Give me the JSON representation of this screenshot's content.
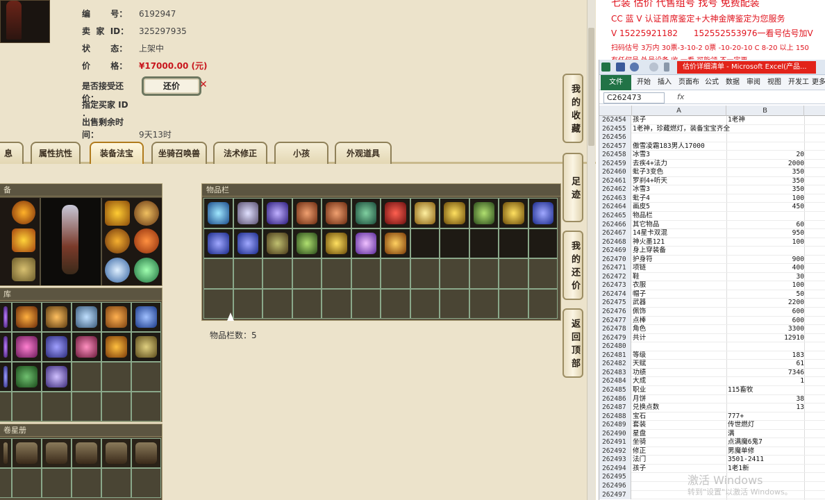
{
  "listing": {
    "rows": [
      {
        "key": "编       号：",
        "value": "6192947"
      },
      {
        "key": "卖  家  ID：",
        "value": "325297935"
      },
      {
        "key": "状       态：",
        "value": "上架中"
      },
      {
        "key": "价       格：",
        "value": "¥17000.00 (元)"
      },
      {
        "key": "是否接受还价：",
        "value": ""
      },
      {
        "key": "指定买家 ID ：",
        "value": ""
      },
      {
        "key": "出售剩余时间：",
        "value": "9天13时"
      }
    ],
    "counter_offer_label": "还价",
    "counter_offer_x": "✕"
  },
  "tabs": [
    {
      "label": "息"
    },
    {
      "label": "属性抗性"
    },
    {
      "label": "装备法宝"
    },
    {
      "label": "坐骑召唤兽"
    },
    {
      "label": "法术修正"
    },
    {
      "label": "小孩"
    },
    {
      "label": "外观道具"
    }
  ],
  "panels": {
    "equipment_title": "备",
    "inventory_title": "物品栏",
    "inventory_count": "物品栏数：5",
    "third_title": "库",
    "fourth_title": "卷星册"
  },
  "side_buttons": [
    {
      "label": "我的收藏"
    },
    {
      "label": "足迹"
    },
    {
      "label": "我的还价"
    },
    {
      "label": "返回顶部"
    }
  ],
  "ads": [
    "七装 估价 代售组号 找号 免费配装",
    "CC 蓝 V 认证首席鉴定+大神金牌鉴定为您服务",
    "V 15225921182      152552553976一看号估号加V",
    "扫码估号 3万内 30票-3-10-2 0票 -10-20-10 C 8-20 以上 150",
    "有任何号 外号设备 收-一看 可能领 不一定更"
  ],
  "excel": {
    "title": "估价详细清单 - Microsoft Excel(产品...",
    "ribbon_tabs": [
      "文件",
      "开始",
      "插入",
      "页面布",
      "公式",
      "数据",
      "审阅",
      "视图",
      "开发工",
      "更多"
    ],
    "name_box": "C262473",
    "fx": "fx",
    "col_a": "A",
    "col_b": "B",
    "rows": [
      {
        "n": "262454",
        "a": "孩子",
        "b": "1老神"
      },
      {
        "n": "262455",
        "a": "1老神，珍藏燃灯，装备宝宝齐全",
        "b": ""
      },
      {
        "n": "262456",
        "a": "",
        "b": ""
      },
      {
        "n": "262457",
        "a": "傲雪凌霜183男人17000",
        "b": ""
      },
      {
        "n": "262458",
        "a": "冰雪3",
        "b": "20"
      },
      {
        "n": "262459",
        "a": "去疾4+法力",
        "b": "2000"
      },
      {
        "n": "262460",
        "a": "蚍子3变色",
        "b": "350"
      },
      {
        "n": "262461",
        "a": "罗刹4+听天",
        "b": "350"
      },
      {
        "n": "262462",
        "a": "冰雪3",
        "b": "350"
      },
      {
        "n": "262463",
        "a": "蚍子4",
        "b": "100"
      },
      {
        "n": "262464",
        "a": "画皮5",
        "b": "450"
      },
      {
        "n": "262465",
        "a": "物品栏",
        "b": ""
      },
      {
        "n": "262466",
        "a": "其它物品",
        "b": "60"
      },
      {
        "n": "262467",
        "a": "14星卡双混",
        "b": "950"
      },
      {
        "n": "262468",
        "a": "神火墨121",
        "b": "100"
      },
      {
        "n": "262469",
        "a": "身上穿装备",
        "b": ""
      },
      {
        "n": "262470",
        "a": "护身符",
        "b": "900"
      },
      {
        "n": "262471",
        "a": "项链",
        "b": "400"
      },
      {
        "n": "262472",
        "a": "鞋",
        "b": "30"
      },
      {
        "n": "262473",
        "a": "衣服",
        "b": "100"
      },
      {
        "n": "262474",
        "a": "帽子",
        "b": "50"
      },
      {
        "n": "262475",
        "a": "武器",
        "b": "2200"
      },
      {
        "n": "262476",
        "a": "佩饰",
        "b": "600"
      },
      {
        "n": "262477",
        "a": "点棒",
        "b": "600"
      },
      {
        "n": "262478",
        "a": "角色",
        "b": "3300"
      },
      {
        "n": "262479",
        "a": "共计",
        "b": "12910"
      },
      {
        "n": "262480",
        "a": "",
        "b": ""
      },
      {
        "n": "262481",
        "a": "等级",
        "b": "183"
      },
      {
        "n": "262482",
        "a": "天赋",
        "b": "61"
      },
      {
        "n": "262483",
        "a": "功绩",
        "b": "7346"
      },
      {
        "n": "262484",
        "a": "大成",
        "b": "1"
      },
      {
        "n": "262485",
        "a": "职业",
        "b": "115畜牧"
      },
      {
        "n": "262486",
        "a": "月饼",
        "b": "38"
      },
      {
        "n": "262487",
        "a": "兑换点数",
        "b": "13"
      },
      {
        "n": "262488",
        "a": "宝石",
        "b": "777+"
      },
      {
        "n": "262489",
        "a": "套装",
        "b": "传世燃灯"
      },
      {
        "n": "262490",
        "a": "星盘",
        "b": "满"
      },
      {
        "n": "262491",
        "a": "坐骑",
        "b": "点满魔6鬼7"
      },
      {
        "n": "262492",
        "a": "修正",
        "b": "男魔单修"
      },
      {
        "n": "262493",
        "a": "法门",
        "b": "3501-2411"
      },
      {
        "n": "262494",
        "a": "孩子",
        "b": "1老1新"
      },
      {
        "n": "262495",
        "a": "",
        "b": ""
      },
      {
        "n": "262496",
        "a": "",
        "b": ""
      },
      {
        "n": "262497",
        "a": "",
        "b": ""
      }
    ]
  },
  "watermark": {
    "line1": "激活 Windows",
    "line2": "转到\"设置\"以激活 Windows。"
  },
  "colors": {
    "price": "#c8161d",
    "ad_red": "#e0141e",
    "excel_green": "#217346",
    "slot_border": "#8aa88a"
  },
  "inventory_icons": [
    "dragon-ring-icon",
    "bat-wing-icon",
    "blue-loop-icon",
    "bead-necklace-icon",
    "bead-necklace-icon",
    "jade-sword-icon",
    "red-medallion-icon",
    "gold-coin-icon",
    "gold-ring-icon",
    "green-charm-icon",
    "gold-ring-icon",
    "blue-robe-icon",
    "blue-robe-icon",
    "blue-robe-icon",
    "green-armor-icon",
    "green-charm-icon",
    "gold-ring-icon",
    "purple-cape-icon",
    "golden-robe-icon"
  ]
}
